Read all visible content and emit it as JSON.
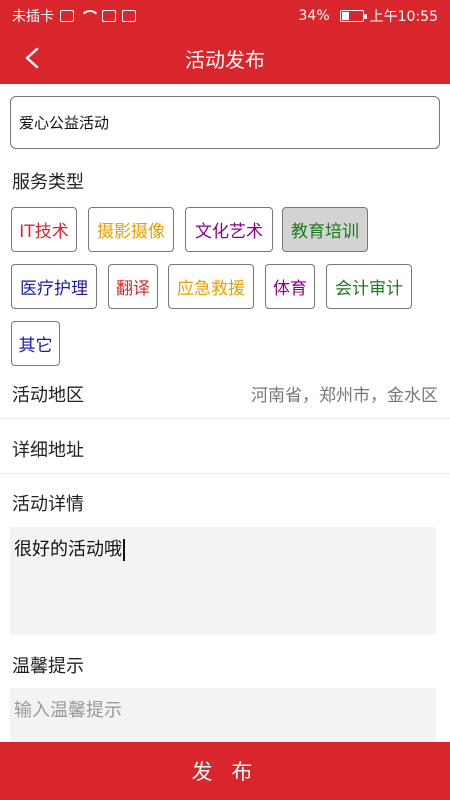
{
  "status_bar": {
    "carrier": "未插卡",
    "battery": "34%",
    "time": "上午10:55",
    "battery_level": 0.34
  },
  "nav": {
    "title": "活动发布",
    "back_icon": "chevron-left-icon"
  },
  "form": {
    "activity_name": "爱心公益活动",
    "service_type_label": "服务类型",
    "service_types": [
      {
        "label": "IT技术",
        "color": "#d9262c",
        "selected": false
      },
      {
        "label": "摄影摄像",
        "color": "#e6a000",
        "selected": false
      },
      {
        "label": "文化艺术",
        "color": "#8b008b",
        "selected": false
      },
      {
        "label": "教育培训",
        "color": "#1a7a1a",
        "selected": true
      },
      {
        "label": "医疗护理",
        "color": "#1a1aa8",
        "selected": false
      },
      {
        "label": "翻译",
        "color": "#d9262c",
        "selected": false
      },
      {
        "label": "应急救援",
        "color": "#e6a000",
        "selected": false
      },
      {
        "label": "体育",
        "color": "#8b008b",
        "selected": false
      },
      {
        "label": "会计审计",
        "color": "#1a7a1a",
        "selected": false
      },
      {
        "label": "其它",
        "color": "#1a1aa8",
        "selected": false
      }
    ],
    "region_label": "活动地区",
    "region_value": "河南省，郑州市，金水区",
    "address_label": "详细地址",
    "details_label": "活动详情",
    "details_value": "很好的活动哦",
    "tips_label": "温馨提示",
    "tips_placeholder": "输入温馨提示"
  },
  "submit_label": "发 布",
  "colors": {
    "brand_red": "#d9262c",
    "selected_chip_bg": "#d3d3d3",
    "textarea_bg": "#f3f3f3"
  }
}
